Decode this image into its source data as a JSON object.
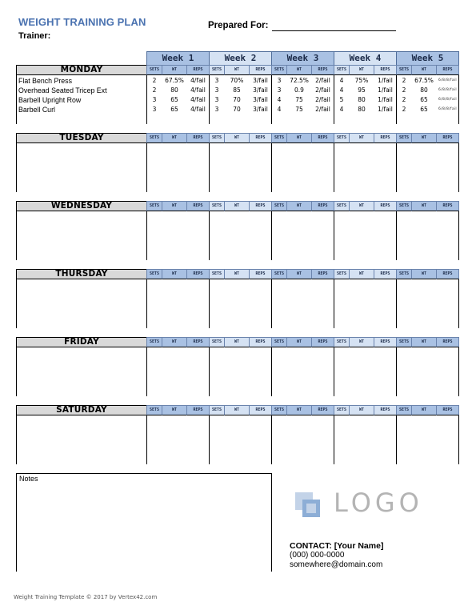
{
  "header": {
    "title": "WEIGHT TRAINING PLAN",
    "trainer_label": "Trainer:",
    "prepared_for_label": "Prepared For:",
    "prepared_for_value": ""
  },
  "colors": {
    "title": "#4a72b0",
    "week_dark": "#a9c1e3",
    "week_light": "#d5e2f3",
    "day_header_bg": "#d9d9d9",
    "logo_text": "#b4b4b4"
  },
  "weeks": [
    {
      "label": "Week 1"
    },
    {
      "label": "Week 2"
    },
    {
      "label": "Week 3"
    },
    {
      "label": "Week 4"
    },
    {
      "label": "Week 5"
    }
  ],
  "subcolumns": {
    "sets": "SETS",
    "wt": "WT",
    "reps": "REPS"
  },
  "days": [
    {
      "name": "MONDAY",
      "exercises": [
        {
          "name": "Flat Bench Press",
          "weeks": [
            {
              "sets": "2",
              "wt": "67.5%",
              "reps": "4/fail"
            },
            {
              "sets": "3",
              "wt": "70%",
              "reps": "3/fail"
            },
            {
              "sets": "3",
              "wt": "72.5%",
              "reps": "2/fail"
            },
            {
              "sets": "4",
              "wt": "75%",
              "reps": "1/fail"
            },
            {
              "sets": "2",
              "wt": "67.5%",
              "reps": "6/8/8/fail"
            }
          ]
        },
        {
          "name": "Overhead Seated Tricep Ext",
          "weeks": [
            {
              "sets": "2",
              "wt": "80",
              "reps": "4/fail"
            },
            {
              "sets": "3",
              "wt": "85",
              "reps": "3/fail"
            },
            {
              "sets": "3",
              "wt": "0.9",
              "reps": "2/fail"
            },
            {
              "sets": "4",
              "wt": "95",
              "reps": "1/fail"
            },
            {
              "sets": "2",
              "wt": "80",
              "reps": "6/8/8/fail"
            }
          ]
        },
        {
          "name": "Barbell Upright Row",
          "weeks": [
            {
              "sets": "3",
              "wt": "65",
              "reps": "4/fail"
            },
            {
              "sets": "3",
              "wt": "70",
              "reps": "3/fail"
            },
            {
              "sets": "4",
              "wt": "75",
              "reps": "2/fail"
            },
            {
              "sets": "5",
              "wt": "80",
              "reps": "1/fail"
            },
            {
              "sets": "2",
              "wt": "65",
              "reps": "6/8/8/fail"
            }
          ]
        },
        {
          "name": "Barbell Curl",
          "weeks": [
            {
              "sets": "3",
              "wt": "65",
              "reps": "4/fail"
            },
            {
              "sets": "3",
              "wt": "70",
              "reps": "3/fail"
            },
            {
              "sets": "4",
              "wt": "75",
              "reps": "2/fail"
            },
            {
              "sets": "4",
              "wt": "80",
              "reps": "1/fail"
            },
            {
              "sets": "2",
              "wt": "65",
              "reps": "6/8/8/fail"
            }
          ]
        }
      ]
    },
    {
      "name": "TUESDAY",
      "exercises": []
    },
    {
      "name": "WEDNESDAY",
      "exercises": []
    },
    {
      "name": "THURSDAY",
      "exercises": []
    },
    {
      "name": "FRIDAY",
      "exercises": []
    },
    {
      "name": "SATURDAY",
      "exercises": []
    }
  ],
  "notes": {
    "label": "Notes",
    "value": ""
  },
  "logo": {
    "text": "LOGO",
    "icon": "overlapping-squares-icon"
  },
  "contact": {
    "name_line": "CONTACT: [Your Name]",
    "phone": "(000) 000-0000",
    "email": "somewhere@domain.com"
  },
  "footer": {
    "text": "Weight Training Template © 2017 by Vertex42.com"
  }
}
